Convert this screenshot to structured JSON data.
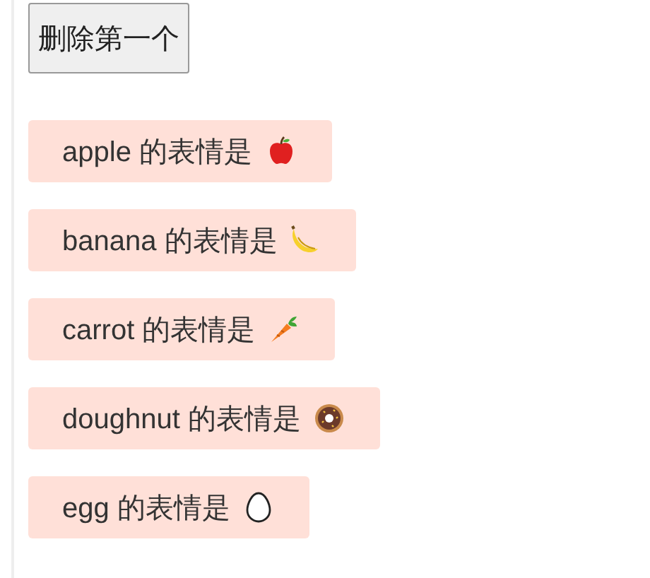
{
  "button": "删除第一个",
  "items": [
    {
      "text": "apple 的表情是",
      "kind": "apple"
    },
    {
      "text": "banana 的表情是",
      "kind": "banana"
    },
    {
      "text": "carrot 的表情是",
      "kind": "carrot"
    },
    {
      "text": "doughnut 的表情是",
      "kind": "doughnut"
    },
    {
      "text": "egg 的表情是",
      "kind": "egg"
    }
  ]
}
